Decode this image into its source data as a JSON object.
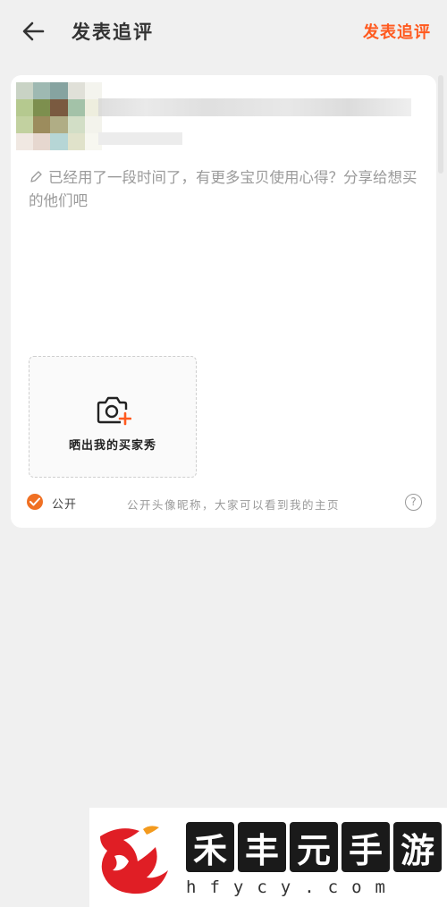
{
  "header": {
    "title": "发表追评",
    "publish_label": "发表追评"
  },
  "product": {
    "thumb_colors": [
      "#c9d3c5",
      "#9eb9b2",
      "#86a3a0",
      "#e0e0d8",
      "#f4f4ee",
      "#b5c98f",
      "#7d8f4e",
      "#7a5a40",
      "#a3c2a8",
      "#eeeede",
      "#c2d1a0",
      "#9c8c5d",
      "#b0ad85",
      "#d2dec6",
      "#f3f3ec",
      "#f0e8e2",
      "#e6d7cf",
      "#b6d6d6",
      "#e0e2ca",
      "#f7f7f0"
    ]
  },
  "review": {
    "placeholder": "已经用了一段时间了，有更多宝贝使用心得？分享给想买的他们吧"
  },
  "photo": {
    "label": "晒出我的买家秀"
  },
  "public": {
    "label": "公开",
    "note": "公开头像昵称，大家可以看到我的主页",
    "help": "?",
    "checked": true
  },
  "watermark": {
    "chars": [
      "禾",
      "丰",
      "元",
      "手",
      "游"
    ],
    "domain": "hfycy.com"
  },
  "colors": {
    "accent": "#ff5a1f",
    "check": "#f07023"
  }
}
